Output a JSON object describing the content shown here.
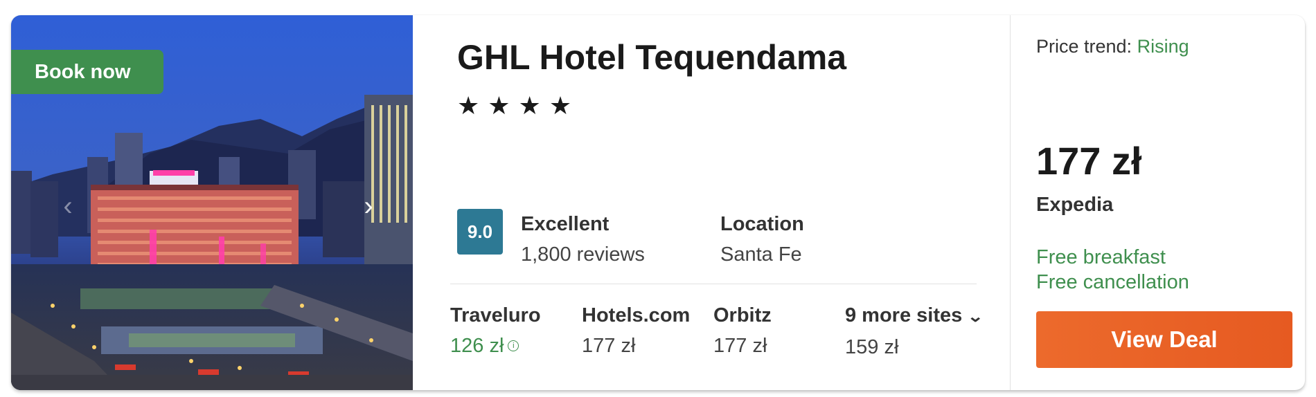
{
  "badge": {
    "book_now": "Book now"
  },
  "hotel": {
    "name": "GHL Hotel Tequendama",
    "stars": "★★★★"
  },
  "rating": {
    "score": "9.0",
    "label": "Excellent",
    "reviews": "1,800 reviews"
  },
  "location": {
    "label": "Location",
    "value": "Santa Fe"
  },
  "providers": [
    {
      "name": "Traveluro",
      "price": "126 zł"
    },
    {
      "name": "Hotels.com",
      "price": "177 zł"
    },
    {
      "name": "Orbitz",
      "price": "177 zł"
    },
    {
      "name": "9 more sites",
      "price": "159 zł"
    }
  ],
  "deal": {
    "trend_label": "Price trend:",
    "trend_value": "Rising",
    "price": "177 zł",
    "provider": "Expedia",
    "perks": [
      "Free breakfast",
      "Free cancellation"
    ],
    "button": "View Deal"
  },
  "icons": {
    "prev": "chevron-left-icon",
    "next": "chevron-right-icon",
    "info": "info-icon",
    "expand": "chevron-down-icon"
  },
  "colors": {
    "accent_green": "#3f8f4e",
    "rating_blue": "#2d7994",
    "deal_orange": "#e8612a"
  }
}
